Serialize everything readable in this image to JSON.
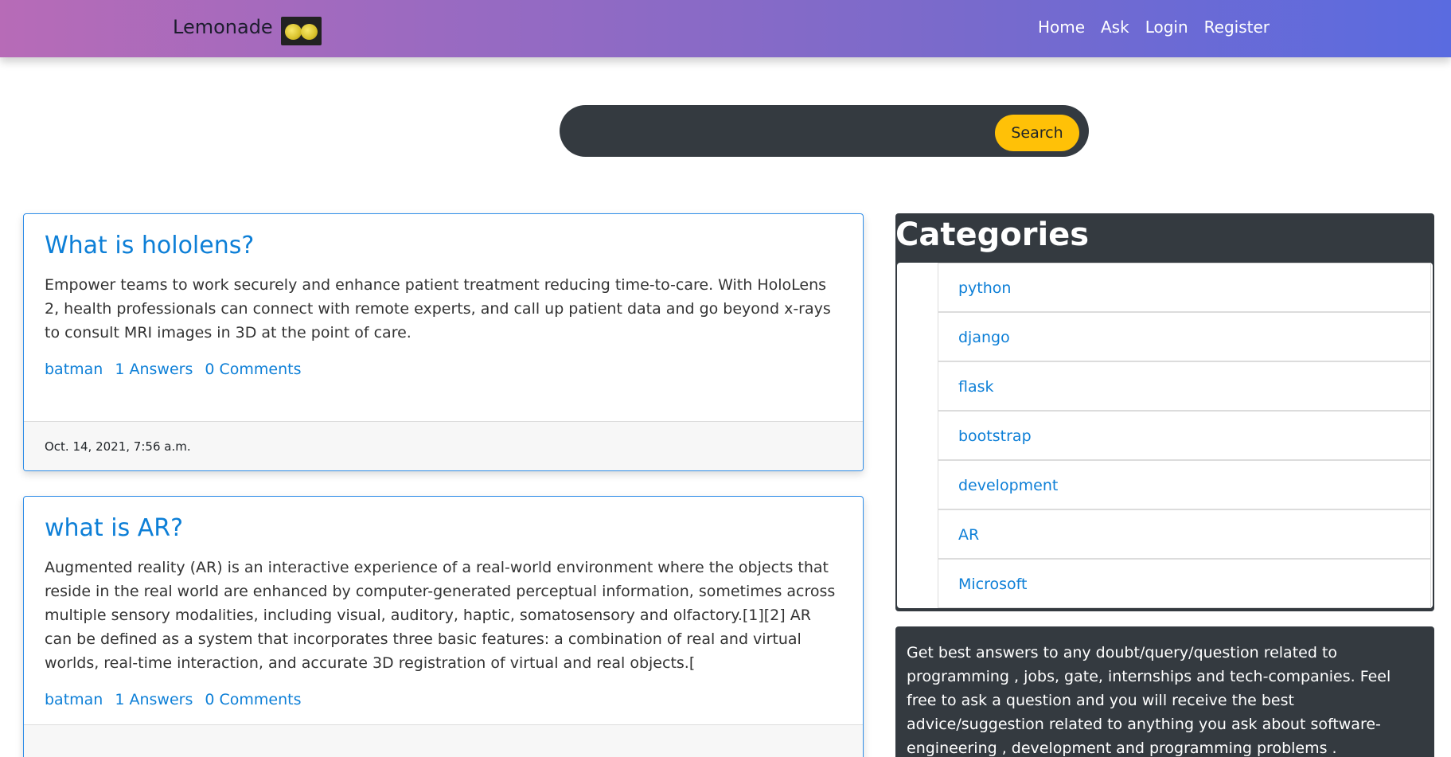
{
  "navbar": {
    "brand": "Lemonade",
    "links": [
      "Home",
      "Ask",
      "Login",
      "Register"
    ]
  },
  "search": {
    "placeholder": "",
    "button_label": "Search"
  },
  "questions": [
    {
      "title": "What is hololens?",
      "body": "Empower teams to work securely and enhance patient treatment reducing time-to-care. With HoloLens 2, health professionals can connect with remote experts, and call up patient data and go beyond x-rays to consult MRI images in 3D at the point of care.",
      "author": "batman",
      "answers": "1 Answers",
      "comments": "0 Comments",
      "date": "Oct. 14, 2021, 7:56 a.m."
    },
    {
      "title": "what is AR?",
      "body": "Augmented reality (AR) is an interactive experience of a real-world environment where the objects that reside in the real world are enhanced by computer-generated perceptual information, sometimes across multiple sensory modalities, including visual, auditory, haptic, somatosensory and olfactory.[1][2] AR can be defined as a system that incorporates three basic features: a combination of real and virtual worlds, real-time interaction, and accurate 3D registration of virtual and real objects.[",
      "author": "batman",
      "answers": "1 Answers",
      "comments": "0 Comments"
    }
  ],
  "categories": {
    "header": "Categories",
    "items": [
      "python",
      "django",
      "flask",
      "bootstrap",
      "development",
      "AR",
      "Microsoft"
    ]
  },
  "about": {
    "text": "Get best answers to any doubt/query/question related to programming , jobs, gate, internships and tech-companies. Feel free to ask a question and you will receive the best advice/suggestion related to anything you ask about software-engineering , development and programming problems ."
  },
  "colors": {
    "accent": "#0d7fd7",
    "search_button": "#ffc107",
    "dark_panel": "#343a40"
  }
}
